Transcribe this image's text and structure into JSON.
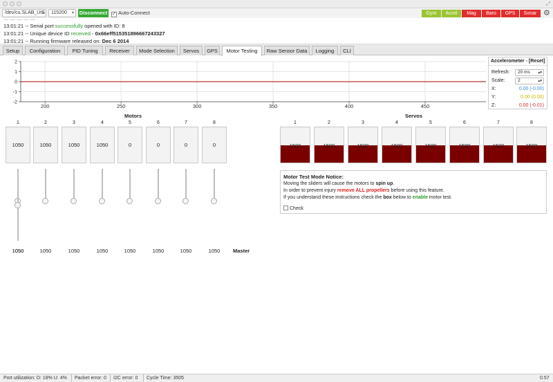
{
  "colors": {
    "accent_green": "#37a835",
    "sensor_on": "#9bc430",
    "sensor_off": "#e12d2d",
    "trace_red": "#b00000",
    "servo_fill": "#7a0000"
  },
  "header": {
    "port": "/dev/cu.SLAB_UtS",
    "baud": "115200",
    "disconnect_label": "Disconnect",
    "auto_connect_label": "Auto-Connect",
    "auto_connect_checked": "✓",
    "sensors": [
      {
        "label": "Gyro",
        "state": "on"
      },
      {
        "label": "Accel",
        "state": "on"
      },
      {
        "label": "Mag",
        "state": "off"
      },
      {
        "label": "Baro",
        "state": "off"
      },
      {
        "label": "GPS",
        "state": "off"
      },
      {
        "label": "Sonar",
        "state": "off"
      }
    ],
    "settings_icon": "gear-icon"
  },
  "log": [
    {
      "time": "13:01:21",
      "pre": " -- Serial port ",
      "hl": "successfully",
      "post": " opened with ID: 8"
    },
    {
      "time": "13:01:21",
      "pre": " -- Unique device ID ",
      "hl": "received",
      "post": " - ",
      "bold": "0x66eff515351896667243327"
    },
    {
      "time": "13:01:21",
      "pre": " -- Running firmware released on: ",
      "bold": "Dec 6 2014"
    }
  ],
  "tabs": [
    "Setup",
    "Configuration",
    "PID Tuning",
    "Receiver",
    "Mode Selection",
    "Servos",
    "GPS",
    "Motor Testing",
    "Raw Sensor Data",
    "Logging",
    "CLI"
  ],
  "active_tab": "Motor Testing",
  "chart_data": {
    "type": "line",
    "x_ticks": [
      200,
      250,
      300,
      350,
      400,
      450
    ],
    "xlim": [
      184,
      490
    ],
    "y_ticks": [
      2,
      1,
      0,
      -1,
      -2
    ],
    "ylim": [
      -2,
      2
    ],
    "series": [
      {
        "values": [
          [
            184,
            0
          ],
          [
            490,
            0
          ]
        ]
      }
    ]
  },
  "accelerometer": {
    "title": "Accelerometer - [Reset]",
    "refresh_label": "Refresh:",
    "refresh_value": "20 ms",
    "scale_label": "Scale:",
    "scale_value": "2",
    "x_label": "X:",
    "x_value": "0.00 (-0.00)",
    "y_label": "Y:",
    "y_value": "0.00 (0.00)",
    "z_label": "Z:",
    "z_value": "0.00 (-0.01)"
  },
  "motors": {
    "title": "Motors",
    "items": [
      {
        "num": "1",
        "value": "1050",
        "slider": "1050"
      },
      {
        "num": "2",
        "value": "1050",
        "slider": "1050"
      },
      {
        "num": "3",
        "value": "1050",
        "slider": "1050"
      },
      {
        "num": "4",
        "value": "1050",
        "slider": "1050"
      },
      {
        "num": "5",
        "value": "0",
        "slider": "1050"
      },
      {
        "num": "6",
        "value": "0",
        "slider": "1050"
      },
      {
        "num": "7",
        "value": "0",
        "slider": "1050"
      },
      {
        "num": "8",
        "value": "0",
        "slider": "1050"
      }
    ],
    "master_value": "1050",
    "master_label": "Master"
  },
  "servos": {
    "title": "Servos",
    "items": [
      {
        "num": "1",
        "value": "1500",
        "fill": 0.5
      },
      {
        "num": "2",
        "value": "1500",
        "fill": 0.5
      },
      {
        "num": "3",
        "value": "1500",
        "fill": 0.5
      },
      {
        "num": "4",
        "value": "1500",
        "fill": 0.5
      },
      {
        "num": "5",
        "value": "1500",
        "fill": 0.5
      },
      {
        "num": "6",
        "value": "1500",
        "fill": 0.5
      },
      {
        "num": "7",
        "value": "1500",
        "fill": 0.5
      },
      {
        "num": "8",
        "value": "1500",
        "fill": 0.5
      }
    ]
  },
  "notice": {
    "title": "Motor Test Mode Notice:",
    "line1_pre": "Moving the sliders will cause the motors to ",
    "line1_bold": "spin up",
    "line1_post": ".",
    "line2_pre": "In order to prevent injury ",
    "line2_red": "remove ALL propellers",
    "line2_post": " before using this feature.",
    "line3_pre": "If you understand these instructions check the ",
    "line3_bold": "box",
    "line3_mid": " below to ",
    "line3_green": "enable",
    "line3_post": " motor test.",
    "check_label": "Check"
  },
  "status": {
    "port_util": "Port utilization: D: 18% U: 4%",
    "packet_error": "Packet error: 0",
    "i2c_error": "I2C error: 0",
    "cycle_time": "Cycle Time: 3505",
    "version": "0.57"
  }
}
